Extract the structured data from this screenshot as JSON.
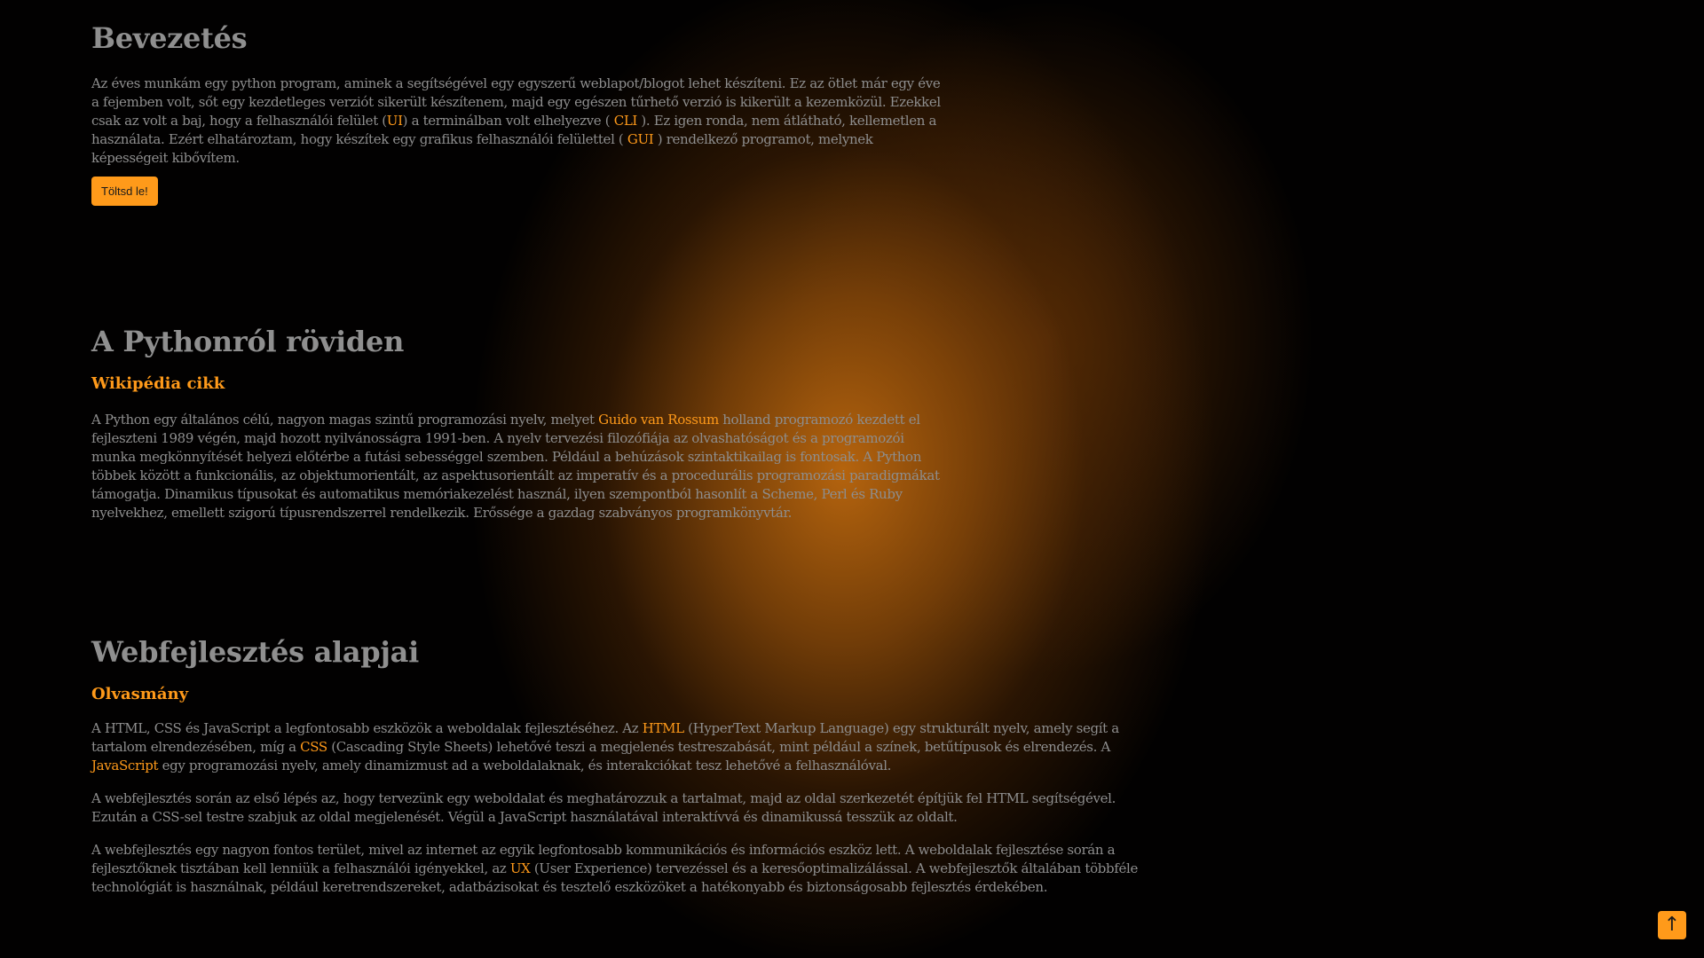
{
  "sections": {
    "intro": {
      "title": "Bevezetés",
      "text_1": "Az éves munkám egy python program, aminek a segítségével egy egyszerű weblapot/blogot lehet készíteni. Ez az ötlet már egy éve a fejemben volt, sőt egy kezdetleges verziót sikerült készítenem, majd egy egészen tűrhető verzió is kikerült a kezemközül. Ezekkel csak az volt a baj, hogy a felhasználói felület (",
      "link_ui": "UI",
      "text_2": ") a terminálban volt elhelyezve ( ",
      "link_cli": "CLI",
      "text_3": " ). Ez igen ronda, nem átlátható, kellemetlen a használata. Ezért elhatároztam, hogy készítek egy grafikus felhasználói felülettel ( ",
      "link_gui": "GUI",
      "text_4": " ) rendelkező programot, melynek képességeit kibővítem.",
      "download_label": "Töltsd le!"
    },
    "python": {
      "title": "A Pythonról röviden",
      "subtitle": "Wikipédia cikk",
      "text_1": "A Python egy általános célú, nagyon magas szintű programozási nyelv, melyet ",
      "link_guido": "Guido van Rossum",
      "text_2": " holland programozó kezdett el fejleszteni 1989 végén, majd hozott nyilvánosságra 1991-ben. A nyelv tervezési filozófiája az olvashatóságot és a programozói munka megkönnyítését helyezi előtérbe a futási sebességgel szemben. Például a behúzások szintaktikailag is fontosak. A Python többek között a funkcionális, az objektumorientált, az aspektusorientált az imperatív és a procedurális programozási paradigmákat támogatja. Dinamikus típusokat és automatikus memóriakezelést használ, ilyen szempontból hasonlít a Scheme, Perl és Ruby nyelvekhez, emellett szigorú típusrendszerrel rendelkezik. Erőssége a gazdag szabványos programkönyvtár."
    },
    "webdev": {
      "title": "Webfejlesztés alapjai",
      "subtitle": "Olvasmány",
      "p1_text_1": "A HTML, CSS és JavaScript a legfontosabb eszközök a weboldalak fejlesztéséhez. Az ",
      "p1_link_html": "HTML",
      "p1_text_2": " (HyperText Markup Language) egy strukturált nyelv, amely segít a tartalom elrendezésében, míg a ",
      "p1_link_css": "CSS",
      "p1_text_3": " (Cascading Style Sheets) lehetővé teszi a megjelenés testreszabását, mint például a színek, betűtípusok és elrendezés. A ",
      "p1_link_js": "JavaScript",
      "p1_text_4": " egy programozási nyelv, amely dinamizmust ad a weboldalaknak, és interakciókat tesz lehetővé a felhasználóval.",
      "p2": "A webfejlesztés során az első lépés az, hogy tervezünk egy weboldalat és meghatározzuk a tartalmat, majd az oldal szerkezetét építjük fel HTML segítségével. Ezután a CSS-sel testre szabjuk az oldal megjelenését. Végül a JavaScript használatával interaktívvá és dinamikussá tesszük az oldalt.",
      "p3_text_1": "A webfejlesztés egy nagyon fontos terület, mivel az internet az egyik legfontosabb kommunikációs és információs eszköz lett. A weboldalak fejlesztése során a fejlesztőknek tisztában kell lenniük a felhasználói igényekkel, az ",
      "p3_link_ux": "UX",
      "p3_text_2": " (User Experience) tervezéssel és a keresőoptimalizálással. A webfejlesztők általában többféle technológiát is használnak, például keretrendszereket, adatbázisokat és tesztelő eszközöket a hatékonyabb és biztonságosabb fejlesztés érdekében."
    }
  },
  "scroll_top_icon": "arrow-up-icon",
  "scroll_top_glyph": "↑",
  "colors": {
    "accent": "#ff9a1a",
    "background": "#020101",
    "text": "#8e8e8e"
  }
}
